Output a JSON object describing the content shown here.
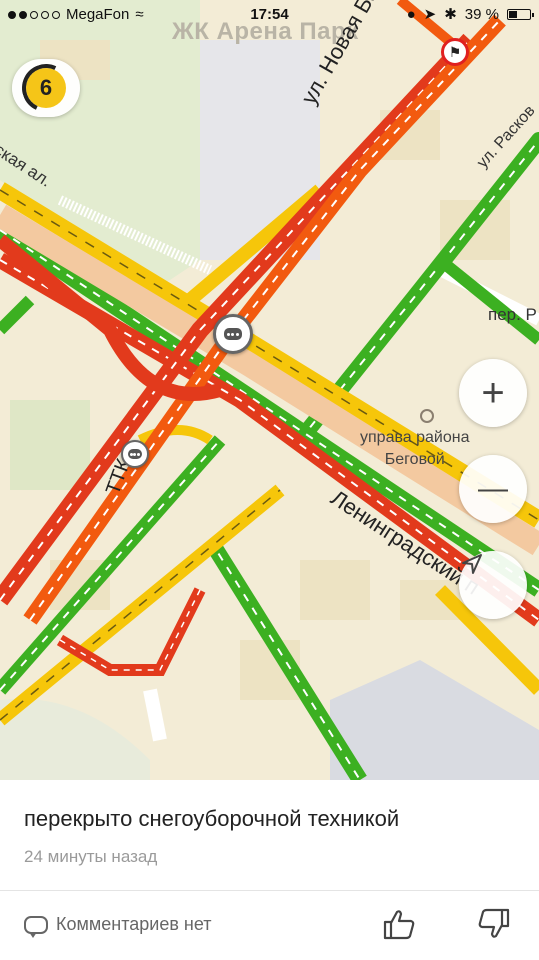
{
  "status_bar": {
    "carrier": "MegaFon",
    "time": "17:54",
    "battery": "39 %",
    "signal_dots_filled": 2,
    "signal_dots_total": 5
  },
  "map": {
    "area_label": "ЖК Арена Парк",
    "poi_label_line1": "управа района",
    "poi_label_line2": "Беговой",
    "street_labels": {
      "novaya_bashilovka": "ул. Новая Башил",
      "leningradsky": "Ленинградский п",
      "alley": "овская ал.",
      "per": "пер. Р",
      "top_right": "ул. Расков",
      "ttk": "ТТК"
    },
    "traffic_score": "6",
    "traffic_level_color": "#f5c518",
    "colors": {
      "road_red": "#e23a1c",
      "road_orange": "#f25a0f",
      "road_yellow": "#f6c60a",
      "road_green": "#3cb021"
    }
  },
  "controls": {
    "zoom_in_label": "+",
    "zoom_out_label": "—"
  },
  "event": {
    "title": "перекрыто снегоуборочной техникой",
    "time_ago": "24 минуты назад",
    "comments_label": "Комментариев нет"
  }
}
